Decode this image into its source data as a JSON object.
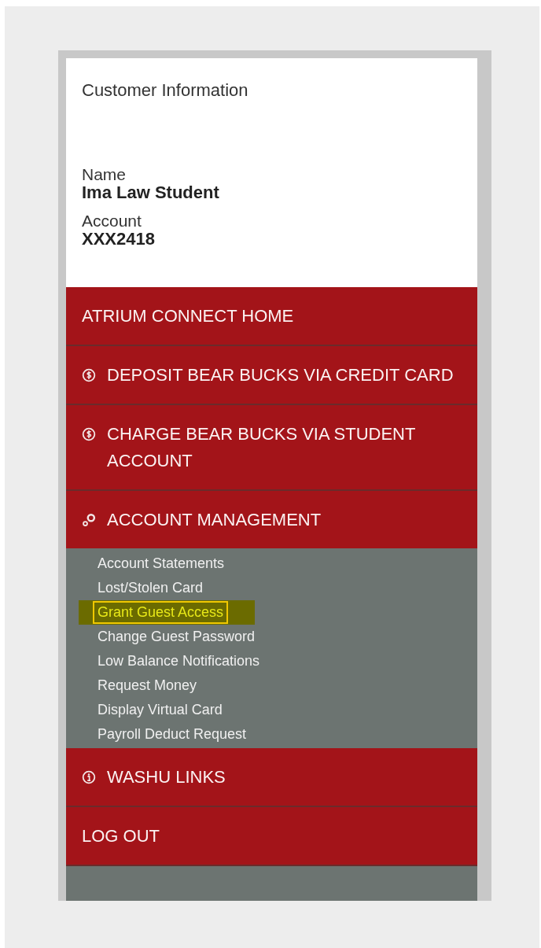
{
  "customer_panel": {
    "title": "Customer Information",
    "fields": [
      {
        "label": "Name",
        "value": "Ima Law Student"
      },
      {
        "label": "Account",
        "value": "XXX2418"
      }
    ]
  },
  "nav": [
    {
      "label": "ATRIUM CONNECT HOME",
      "kind": "plain"
    },
    {
      "label": "DEPOSIT BEAR BUCKS VIA CREDIT CARD",
      "kind": "dollar"
    },
    {
      "label": "CHARGE BEAR BUCKS VIA STUDENT ACCOUNT",
      "kind": "dollar"
    },
    {
      "label": "ACCOUNT MANAGEMENT",
      "kind": "gears",
      "expanded": true,
      "children": [
        {
          "label": "Account Statements",
          "selected": false
        },
        {
          "label": "Lost/Stolen Card",
          "selected": false
        },
        {
          "label": "Grant Guest Access",
          "selected": true
        },
        {
          "label": "Change Guest Password",
          "selected": false
        },
        {
          "label": "Low Balance Notifications",
          "selected": false
        },
        {
          "label": "Request Money",
          "selected": false
        },
        {
          "label": "Display Virtual Card",
          "selected": false
        },
        {
          "label": "Payroll Deduct Request",
          "selected": false
        }
      ]
    },
    {
      "label": "WASHU LINKS",
      "kind": "info"
    },
    {
      "label": "LOG OUT",
      "kind": "plain"
    }
  ]
}
